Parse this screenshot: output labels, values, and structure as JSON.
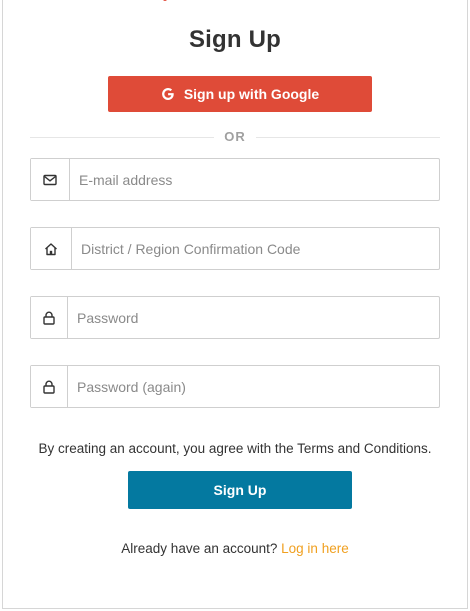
{
  "page": {
    "title": "Sign Up"
  },
  "google_button": {
    "label": "Sign up with Google",
    "icon": "google-g-icon",
    "color": "#df4b38"
  },
  "divider": {
    "text": "OR"
  },
  "fields": {
    "email": {
      "placeholder": "E-mail address",
      "value": "",
      "icon": "envelope-icon"
    },
    "region_code": {
      "placeholder": "District / Region Confirmation Code",
      "value": "",
      "icon": "home-icon"
    },
    "password": {
      "placeholder": "Password",
      "value": "",
      "icon": "lock-icon"
    },
    "password_again": {
      "placeholder": "Password (again)",
      "value": "",
      "icon": "lock-icon"
    }
  },
  "terms_text": "By creating an account, you agree with the Terms and Conditions.",
  "signup_button": {
    "label": "Sign Up",
    "color": "#0479a0"
  },
  "login": {
    "prompt": "Already have an account?",
    "link_label": "Log in here",
    "link_color": "#f0a020"
  }
}
